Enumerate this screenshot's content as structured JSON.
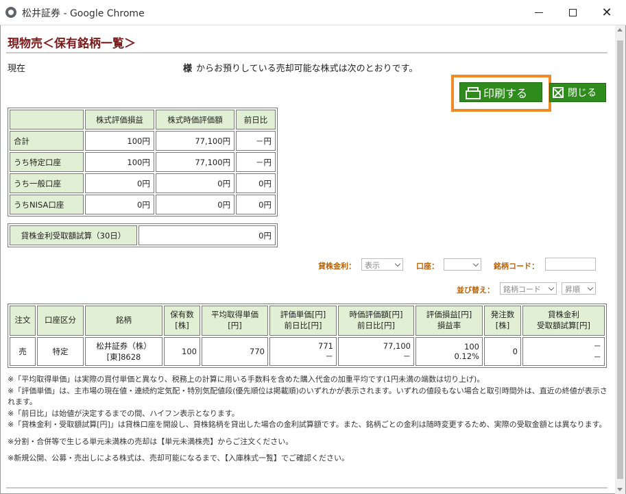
{
  "window": {
    "title": "松井証券 - Google Chrome",
    "minimize_label": "—",
    "close_glyph": "✕"
  },
  "page": {
    "title": "現物売＜保有銘柄一覧＞",
    "status_left": "現在",
    "status_honorific": "様",
    "status_msg": "からお預りしている売却可能な株式は次のとおりです。"
  },
  "buttons": {
    "print_label": "印刷する",
    "close_label": "閉じる"
  },
  "summary": {
    "headers": [
      "株式評価損益",
      "株式時価評価額",
      "前日比"
    ],
    "rows": [
      {
        "label": "合計",
        "values": [
          "100円",
          "77,100円",
          "－円"
        ]
      },
      {
        "label": "うち特定口座",
        "values": [
          "100円",
          "77,100円",
          "－円"
        ]
      },
      {
        "label": "うち一般口座",
        "values": [
          "0円",
          "0円",
          "0円"
        ]
      },
      {
        "label": "うちNISA口座",
        "values": [
          "0円",
          "0円",
          "0円"
        ]
      }
    ]
  },
  "lending": {
    "label": "貸株金利受取額試算（30日）",
    "value": "0円"
  },
  "filters": {
    "lending_rate_label": "貸株金利：",
    "lending_rate_value": "表示",
    "account_label": "口座：",
    "account_value": "",
    "code_label": "銘柄コード：",
    "code_value": "",
    "sort_label": "並び替え：",
    "sort_key_value": "銘柄コード",
    "sort_order_value": "昇順"
  },
  "holdings": {
    "headers": [
      [
        "注文"
      ],
      [
        "口座区分"
      ],
      [
        "銘柄"
      ],
      [
        "保有数",
        "[株]"
      ],
      [
        "平均取得単価",
        "[円]"
      ],
      [
        "評価単価[円]",
        "前日比[円]"
      ],
      [
        "時価評価額[円]",
        "前日比[円]"
      ],
      [
        "評価損益[円]",
        "損益率"
      ],
      [
        "発注数",
        "[株]"
      ],
      [
        "貸株金利",
        "受取額試算[円]"
      ]
    ],
    "rows": [
      {
        "order": "売",
        "account_type": "特定",
        "issue_name": "松井証券（株）",
        "issue_code": "[東]8628",
        "quantity": "100",
        "avg_price": "770",
        "eval_price": "771",
        "eval_price_change": "－",
        "market_value": "77,100",
        "market_value_change": "－",
        "profit_loss": "100",
        "profit_rate": "0.12%",
        "order_qty": "0",
        "lending_interest_1": "－",
        "lending_interest_2": "－"
      }
    ]
  },
  "notes": [
    "※「平均取得単価」は実際の買付単価と異なり、税務上の計算に用いる手数料を含めた購入代金の加重平均です(1円未満の端数は切り上げ)。",
    "※「評価単価」は、主市場の現在値・連続約定気配・特別気配値段(優先順位は掲載順)のいずれかが表示されます。いずれの値段もない場合と取引時間外は、直近の終値が表示されます。",
    "※「前日比」は始値が決定するまでの間、ハイフン表示となります。",
    "※「貸株金利・受取額試算[円]」は貸株口座を開設し、貸株銘柄を貸出した場合の金利試算額です。また、銘柄ごとの金利は随時変更するため、実際の受取金額とは異なります。",
    "※分割・合併等で生じる単元未満株の売却は【単元未満株売】からご注文ください。",
    "※新規公開、公募・売出しによる株式は、売却可能になるまで、【入庫株式一覧】でご確認ください。"
  ]
}
